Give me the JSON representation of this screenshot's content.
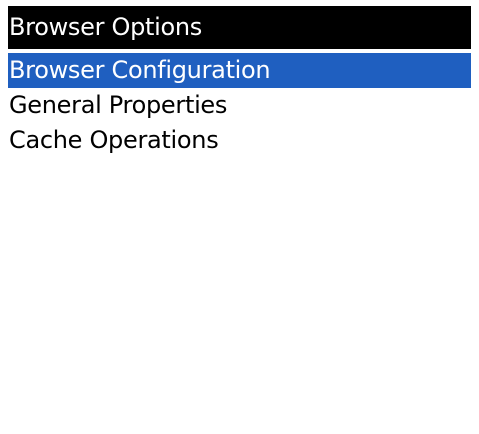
{
  "screen": {
    "title": "Browser Options",
    "selection_color": "#1f5fc0"
  },
  "menu": {
    "items": [
      {
        "label": "Browser Configuration",
        "selected": true
      },
      {
        "label": "General Properties",
        "selected": false
      },
      {
        "label": "Cache Operations",
        "selected": false
      }
    ]
  }
}
